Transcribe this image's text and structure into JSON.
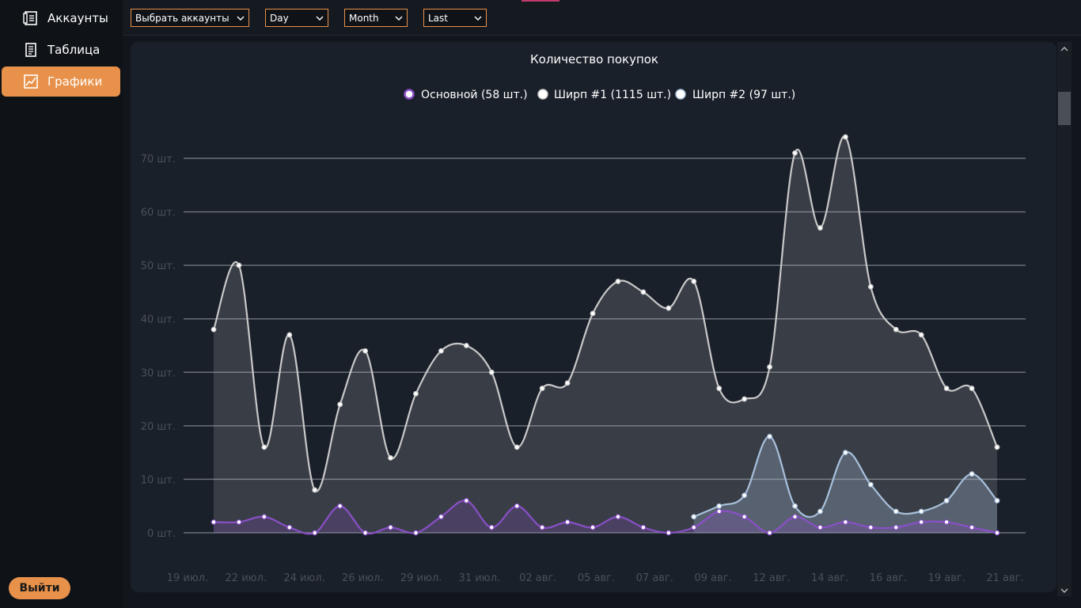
{
  "sidebar": {
    "items": [
      {
        "label": "Аккаунты",
        "icon": "accounts-icon"
      },
      {
        "label": "Таблица",
        "icon": "table-icon"
      },
      {
        "label": "Графики",
        "icon": "chart-icon"
      }
    ],
    "active_index": 2,
    "logout_label": "Выйти"
  },
  "toolbar": {
    "accounts_select": "Выбрать аккаунты",
    "period_select": "Day",
    "range_select": "Month",
    "mode_select": "Last"
  },
  "colors": {
    "accent": "#e8914a",
    "series_main": "#8a4fc8",
    "series_shirp1": "#c8c8c8",
    "series_shirp2": "#a8c0dc"
  },
  "chart_data": {
    "type": "area",
    "title": "Количество покупок",
    "legend_position": "top",
    "grid": true,
    "ylim": [
      0,
      70
    ],
    "yticks": [
      "0 шт.",
      "10 шт.",
      "20 шт.",
      "30 шт.",
      "40 шт.",
      "50 шт.",
      "60 шт.",
      "70 шт."
    ],
    "xticks": [
      "19 июл.",
      "22 июл.",
      "24 июл.",
      "26 июл.",
      "29 июл.",
      "31 июл.",
      "02 авг.",
      "05 авг.",
      "07 авг.",
      "09 авг.",
      "12 авг.",
      "14 авг.",
      "16 авг.",
      "19 авг.",
      "21 авг."
    ],
    "x_index": [
      0,
      1,
      2,
      3,
      4,
      5,
      6,
      7,
      8,
      9,
      10,
      11,
      12,
      13,
      14,
      15,
      16,
      17,
      18,
      19,
      20,
      21,
      22,
      23,
      24,
      25,
      26,
      27,
      28,
      29,
      30,
      31
    ],
    "series": [
      {
        "name": "Ширп #1 (1115 шт.)",
        "color": "#c8c8c8",
        "values": [
          38,
          50,
          16,
          37,
          8,
          24,
          34,
          14,
          26,
          34,
          35,
          30,
          16,
          27,
          28,
          41,
          47,
          45,
          42,
          47,
          27,
          25,
          31,
          71,
          57,
          74,
          46,
          38,
          37,
          27,
          27,
          16
        ]
      },
      {
        "name": "Ширп #2 (97 шт.)",
        "color": "#a8c0dc",
        "values": [
          null,
          null,
          null,
          null,
          null,
          null,
          null,
          null,
          null,
          null,
          null,
          null,
          null,
          null,
          null,
          null,
          null,
          null,
          null,
          3,
          5,
          7,
          18,
          5,
          4,
          15,
          9,
          4,
          4,
          6,
          11,
          6
        ]
      },
      {
        "name": "Основной (58 шт.)",
        "color": "#8a4fc8",
        "values": [
          2,
          2,
          3,
          1,
          0,
          5,
          0,
          1,
          0,
          3,
          6,
          1,
          5,
          1,
          2,
          1,
          3,
          1,
          0,
          1,
          4,
          3,
          0,
          3,
          1,
          2,
          1,
          1,
          2,
          2,
          1,
          0
        ]
      }
    ]
  }
}
